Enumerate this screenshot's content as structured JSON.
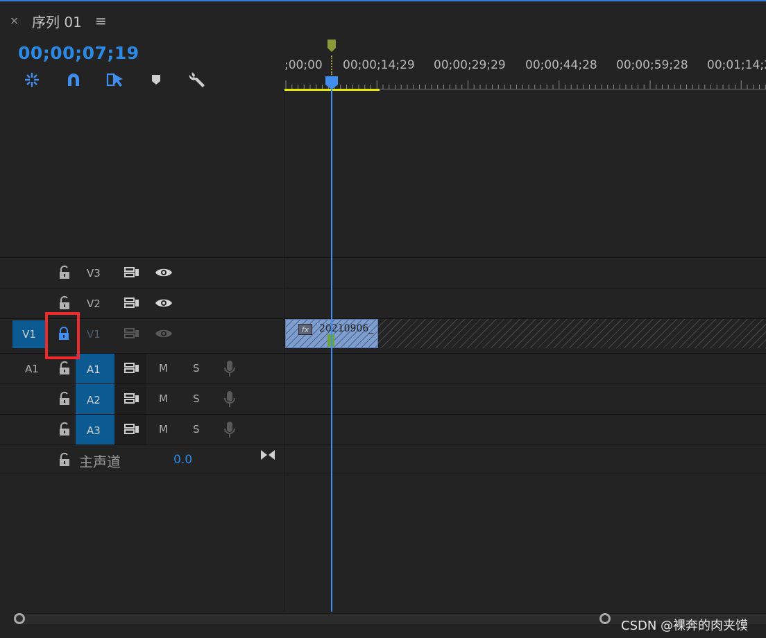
{
  "header": {
    "close_label": "×",
    "sequence_title": "序列 01",
    "menu_label": "≡"
  },
  "timecode": "00;00;07;19",
  "toolbar": {
    "icons": [
      "nest-toggle-icon",
      "snap-magnet-icon",
      "linked-selection-icon",
      "add-marker-icon",
      "wrench-settings-icon"
    ]
  },
  "ruler": {
    "labels": [
      ";00;00",
      "00;00;14;29",
      "00;00;29;29",
      "00;00;44;28",
      "00;00;59;28",
      "00;01;14;2"
    ]
  },
  "video_tracks": [
    {
      "name": "V3",
      "locked": false
    },
    {
      "name": "V2",
      "locked": false
    },
    {
      "name": "V1",
      "source": "V1",
      "locked": true
    }
  ],
  "audio_tracks": [
    {
      "name": "A1",
      "source": "A1",
      "m": "M",
      "s": "S"
    },
    {
      "name": "A2",
      "m": "M",
      "s": "S"
    },
    {
      "name": "A3",
      "m": "M",
      "s": "S"
    }
  ],
  "clip": {
    "fx": "fx",
    "name": "20210906_"
  },
  "master": {
    "label": "主声道",
    "value": "0.0"
  },
  "watermark": "CSDN @裸奔的肉夹馍",
  "colors": {
    "accent": "#2b8ae6",
    "track_patch": "#0b5a91",
    "playhead": "#3f8ef0",
    "work_area": "#e8e800",
    "highlight": "#ee2a2a"
  }
}
